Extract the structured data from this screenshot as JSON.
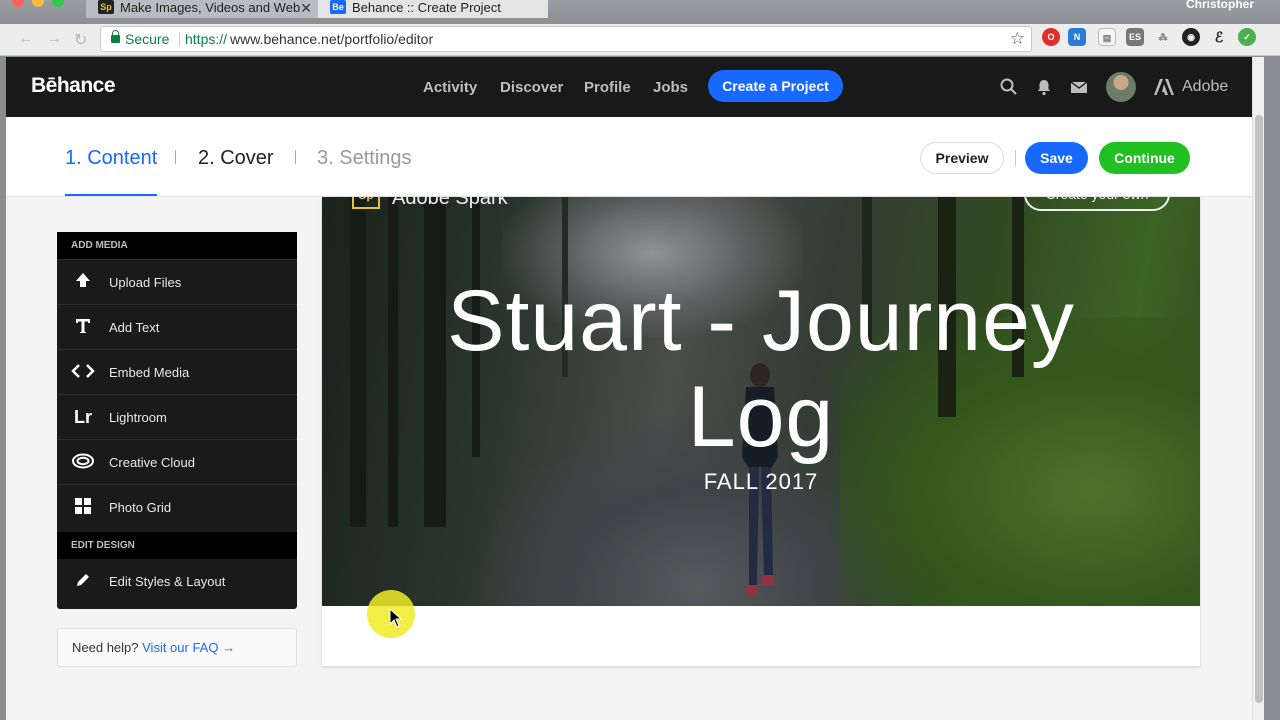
{
  "browser": {
    "tabs": [
      {
        "label": "Make Images, Videos and Web",
        "favicon": "Sp",
        "favicon_color": "#e6c23a"
      },
      {
        "label": "Behance :: Create Project",
        "favicon": "Be",
        "favicon_color": "#1769ff"
      }
    ],
    "profile_name": "Christopher",
    "secure_label": "Secure",
    "url_scheme": "https://",
    "url_rest": "www.behance.net/portfolio/editor"
  },
  "nav": {
    "logo": "Bēhance",
    "links": [
      "Activity",
      "Discover",
      "Profile",
      "Jobs"
    ],
    "create_label": "Create a Project",
    "adobe_label": "Adobe"
  },
  "steps": {
    "items": [
      {
        "label": "1. Content",
        "state": "active"
      },
      {
        "label": "2. Cover",
        "state": "normal"
      },
      {
        "label": "3. Settings",
        "state": "disabled"
      }
    ],
    "preview_label": "Preview",
    "save_label": "Save",
    "continue_label": "Continue"
  },
  "sidebar": {
    "add_media_heading": "ADD MEDIA",
    "tools": [
      {
        "label": "Upload Files",
        "icon": "upload-arrow-icon"
      },
      {
        "label": "Add Text",
        "icon": "text-t-icon"
      },
      {
        "label": "Embed Media",
        "icon": "code-brackets-icon"
      },
      {
        "label": "Lightroom",
        "icon": "lightroom-icon"
      },
      {
        "label": "Creative Cloud",
        "icon": "creative-cloud-icon"
      },
      {
        "label": "Photo Grid",
        "icon": "photo-grid-icon"
      }
    ],
    "edit_design_heading": "EDIT DESIGN",
    "edit_tool": {
      "label": "Edit Styles & Layout",
      "icon": "pencil-icon"
    }
  },
  "help": {
    "prefix": "Need help?",
    "link": "Visit our FAQ →"
  },
  "canvas": {
    "brand_label": "Adobe Spark",
    "brand_icon": "Sp",
    "create_own_label": "Create your own",
    "title_line1": "Stuart - Journey",
    "title_line2": "Log",
    "subtitle": "FALL 2017"
  },
  "colors": {
    "accent_blue": "#1769ff",
    "continue_green": "#1fc01f",
    "nav_bg": "#191919"
  }
}
